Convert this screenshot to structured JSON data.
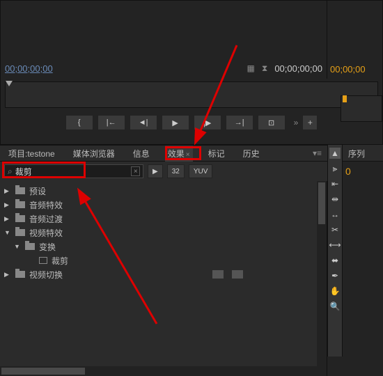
{
  "preview": {
    "timecode_left": "00;00;00;00",
    "timecode_right": "00;00;00;00",
    "timecode_seq": "00;00;00"
  },
  "tabs": {
    "project": "项目:",
    "project_name": "testone",
    "media_browser": "媒体浏览器",
    "info": "信息",
    "effects": "效果",
    "markers": "标记",
    "history": "历史"
  },
  "search": {
    "placeholder": "",
    "value": "裁剪"
  },
  "filters": {
    "fx": "▶",
    "thirtytwo": "32",
    "yuv": "YUV"
  },
  "tree": {
    "presets": "预设",
    "audio_fx": "音频特效",
    "audio_trans": "音频过渡",
    "video_fx": "视频特效",
    "transform": "变换",
    "crop": "裁剪",
    "video_trans": "视频切换"
  },
  "sequence": {
    "label": "序列"
  }
}
